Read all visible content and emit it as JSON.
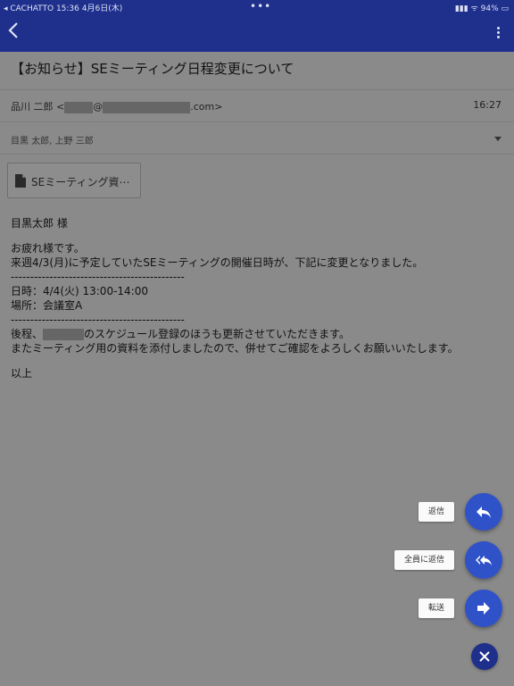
{
  "status": {
    "left": "◂ CACHATTO  15:36  4月6日(木)",
    "right": "▮▮▮ ᯤ 94% ▭"
  },
  "email": {
    "subject": "【お知らせ】SEミーティング日程変更について",
    "from_name": "品川 二郎 <",
    "from_at": "@",
    "from_domain": ".com>",
    "time": "16:27",
    "recipients": "目黒 太郎, 上野 三郎",
    "attachment": "SEミーティング資⋯",
    "body": {
      "greeting": "目黒太郎 様",
      "line1": "お疲れ様です。",
      "line2": "来週4/3(月)に予定していたSEミーティングの開催日時が、下記に変更となりました。",
      "dash1": "---------------------------------------------",
      "datetime": "日時：4/4(火) 13:00-14:00",
      "place": "場所：会議室A",
      "dash2": "---------------------------------------------",
      "after_pre": "後程、",
      "after_post": "のスケジュール登録のほうも更新させていただきます。",
      "line5": "またミーティング用の資料を添付しましたので、併せてご確認をよろしくお願いいたします。",
      "closing": "以上"
    }
  },
  "actions": {
    "reply": "返信",
    "reply_all": "全員に返信",
    "forward": "転送"
  },
  "colors": {
    "nav": "#1e2f8c",
    "fab": "#2f52c9",
    "overlay": "#8a8a8a"
  },
  "icons": [
    "back-chevron-icon",
    "more-vert-icon",
    "file-icon",
    "reply-icon",
    "reply-all-icon",
    "forward-icon",
    "close-icon"
  ]
}
